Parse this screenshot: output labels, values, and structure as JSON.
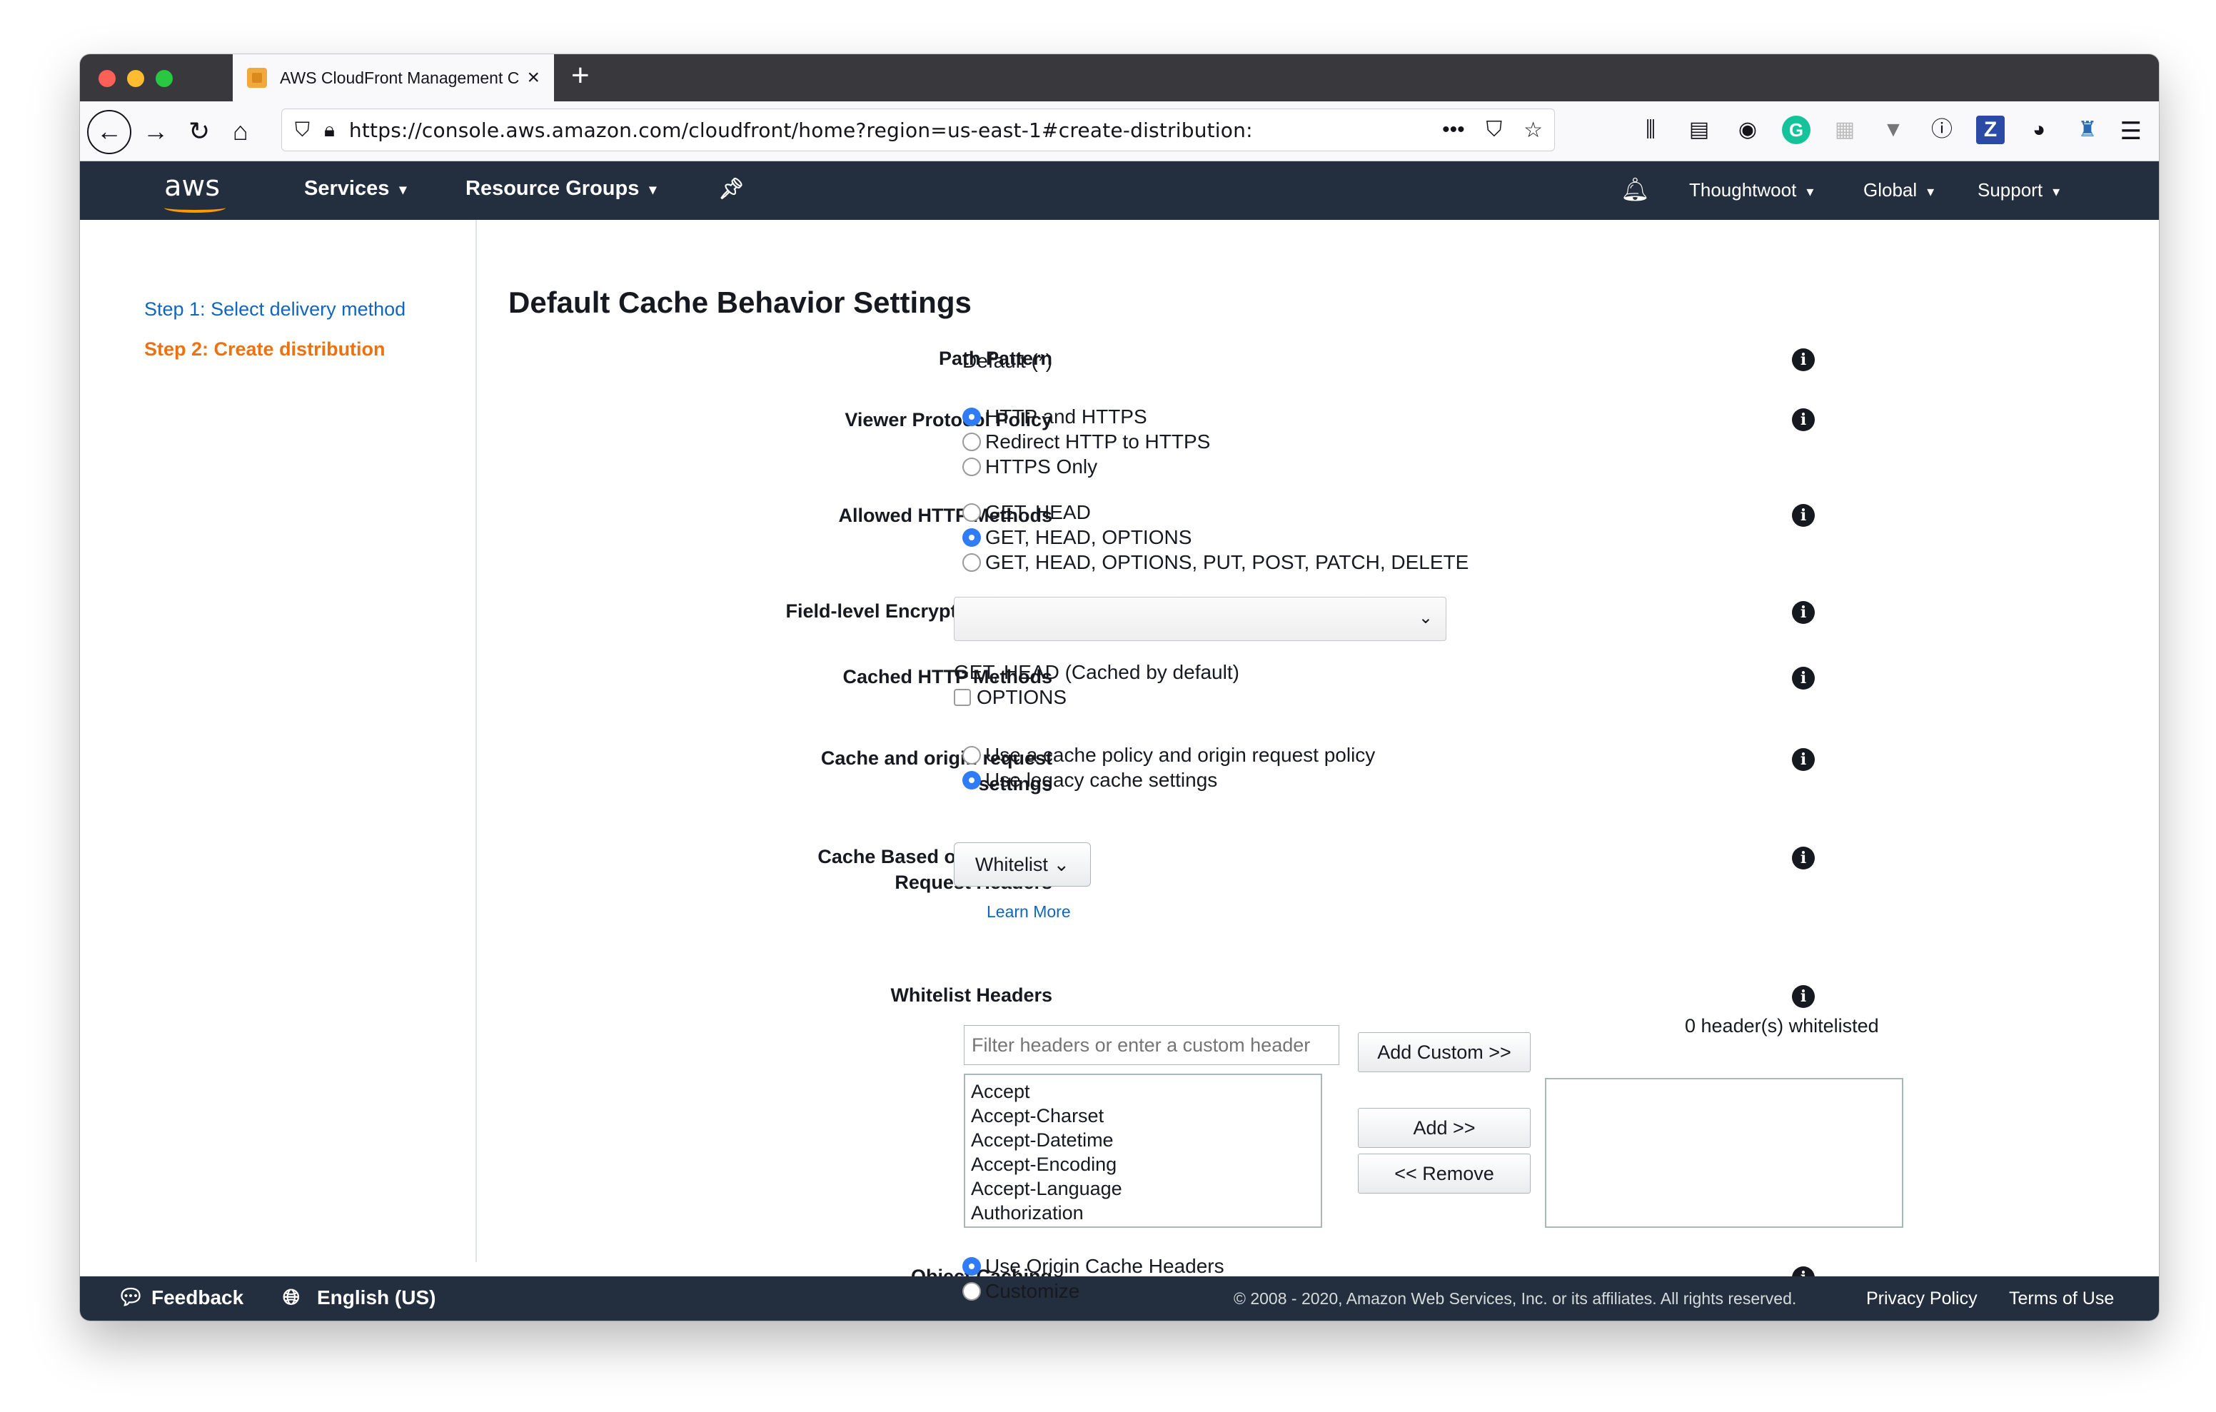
{
  "browser": {
    "tab_title": "AWS CloudFront Management C",
    "url": "https://console.aws.amazon.com/cloudfront/home?region=us-east-1#create-distribution:"
  },
  "aws_nav": {
    "logo": "aws",
    "services": "Services",
    "resource_groups": "Resource Groups",
    "account": "Thoughtwoot",
    "region": "Global",
    "support": "Support"
  },
  "sidebar": {
    "step1": "Step 1: Select delivery method",
    "step2": "Step 2: Create distribution"
  },
  "form": {
    "title": "Default Cache Behavior Settings",
    "path_pattern": {
      "label": "Path Pattern",
      "value": "Default (*)"
    },
    "viewer_protocol": {
      "label": "Viewer Protocol Policy",
      "options": [
        "HTTP and HTTPS",
        "Redirect HTTP to HTTPS",
        "HTTPS Only"
      ],
      "selected": 0
    },
    "allowed_methods": {
      "label": "Allowed HTTP Methods",
      "options": [
        "GET, HEAD",
        "GET, HEAD, OPTIONS",
        "GET, HEAD, OPTIONS, PUT, POST, PATCH, DELETE"
      ],
      "selected": 1
    },
    "field_level": {
      "label": "Field-level Encryption Config",
      "value": ""
    },
    "cached_methods": {
      "label": "Cached HTTP Methods",
      "text": "GET, HEAD (Cached by default)",
      "checkbox": "OPTIONS"
    },
    "cache_origin": {
      "label_line1": "Cache and origin request",
      "label_line2": "settings",
      "options": [
        "Use a cache policy and origin request policy",
        "Use legacy cache settings"
      ],
      "selected": 1
    },
    "cache_headers": {
      "label_line1": "Cache Based on Selected",
      "label_line2": "Request Headers",
      "button": "Whitelist",
      "learn_more": "Learn More"
    },
    "whitelist_headers": {
      "label": "Whitelist Headers",
      "filter_placeholder": "Filter headers or enter a custom header",
      "headers": [
        "Accept",
        "Accept-Charset",
        "Accept-Datetime",
        "Accept-Encoding",
        "Accept-Language",
        "Authorization"
      ],
      "add_custom": "Add Custom >>",
      "add": "Add >>",
      "remove": "<< Remove",
      "count": "0 header(s) whitelisted"
    },
    "object_caching": {
      "label": "Object Caching",
      "options": [
        "Use Origin Cache Headers",
        "Customize"
      ],
      "selected": 0
    }
  },
  "footer": {
    "feedback": "Feedback",
    "language": "English (US)",
    "copyright": "© 2008 - 2020, Amazon Web Services, Inc. or its affiliates. All rights reserved.",
    "privacy": "Privacy Policy",
    "terms": "Terms of Use"
  }
}
